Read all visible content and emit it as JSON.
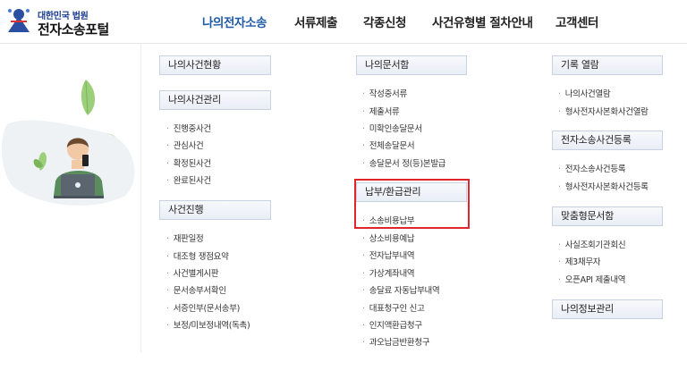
{
  "logo": {
    "sub": "대한민국 법원",
    "main": "전자소송포털"
  },
  "gnb": [
    "나의전자소송",
    "서류제출",
    "각종신청",
    "사건유형별 절차안내",
    "고객센터"
  ],
  "col1": {
    "h1": "나의사건현황",
    "h2": "나의사건관리",
    "h2_items": [
      "진행중사건",
      "관심사건",
      "확정된사건",
      "완료된사건"
    ],
    "h3": "사건진행",
    "h3_items": [
      "재판일정",
      "대조형 쟁점요약",
      "사건별게시판",
      "문서송부서확인",
      "서증인부(문서송부)",
      "보정/미보정내역(독촉)"
    ]
  },
  "col2": {
    "h1": "나의문서함",
    "h1_items": [
      "작성중서류",
      "제출서류",
      "미확인송달문서",
      "전체송달문서",
      "송달문서 정(등)본발급"
    ],
    "h2": "납부/환급관리",
    "h2_items": [
      "소송비용납부",
      "상소비용예납",
      "전자납부내역",
      "가상계좌내역",
      "송달료 자동납부내역",
      "대표청구인 신고",
      "인지액환급청구",
      "과오납금반환청구"
    ]
  },
  "col3": {
    "h1": "기록 열람",
    "h1_items": [
      "나의사건열람",
      "형사전자사본화사건열람"
    ],
    "h2": "전자소송사건등록",
    "h2_items": [
      "전자소송사건등록",
      "형사전자사본화사건등록"
    ],
    "h3": "맞춤형문서함",
    "h3_items": [
      "사실조회기관회신",
      "제3채무자",
      "오픈API 제출내역"
    ],
    "h4": "나의정보관리"
  },
  "colors": {
    "active": "#1f5aa8",
    "highlight": "#e0262b"
  }
}
